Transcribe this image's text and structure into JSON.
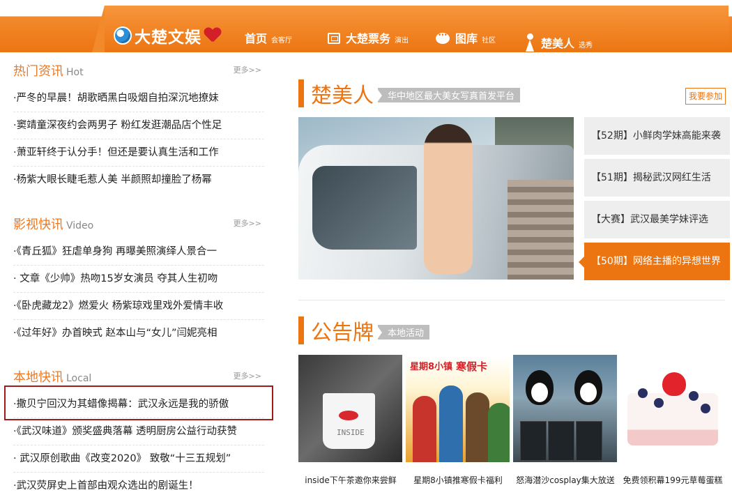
{
  "nav": {
    "logo_text": "大楚文娱",
    "items": [
      {
        "label": "首页",
        "sub": "会客厅"
      },
      {
        "label": "大楚票务",
        "sub": "演出"
      },
      {
        "label": "图库",
        "sub": "社区"
      },
      {
        "label": "楚美人",
        "sub": "选秀"
      }
    ]
  },
  "hot": {
    "title_cn": "热门资讯",
    "title_en": "Hot",
    "more": "更多>>",
    "items": [
      "·严冬的早晨！胡歌晒黑白吸烟自拍深沉地撩妹",
      "·窦靖童深夜约会两男子 粉红发逛潮品店个性足",
      "·萧亚轩终于认分手！但还是要认真生活和工作",
      "·杨紫大眼长睫毛惹人美 半颜照却撞脸了杨幂"
    ]
  },
  "video": {
    "title_cn": "影视快讯",
    "title_en": "Video",
    "more": "更多>>",
    "items": [
      "·《青丘狐》狂虐单身狗 再曝美照演绎人景合一",
      "· 文章《少帅》热吻15岁女演员 夺其人生初吻",
      "·《卧虎藏龙2》燃爱火 杨紫琼戏里戏外爱情丰收",
      "·《过年好》办首映式 赵本山与“女儿”闫妮亮相"
    ]
  },
  "local": {
    "title_cn": "本地快讯",
    "title_en": "Local",
    "more": "更多>>",
    "items": [
      "·撒贝宁回汉为其蜡像揭幕：武汉永远是我的骄傲",
      "·《武汉味道》颁奖盛典落幕 透明厨房公益行动获赞",
      "· 武汉原创歌曲《改变2020》 致敬“十三五规划”",
      "·武汉荧屏史上首部由观众选出的剧诞生！"
    ]
  },
  "beauty": {
    "title": "楚美人",
    "tag": "华中地区最大美女写真首发平台",
    "join": "我要参加",
    "issues": [
      "【52期】小鲜肉学妹高能来袭",
      "【51期】揭秘武汉网红生活",
      "【大赛】武汉最美学妹评选",
      "【50期】网络主播的异想世界"
    ]
  },
  "board": {
    "title": "公告牌",
    "tag": "本地活动",
    "thumb_texts": {
      "t1_word": "INSIDE",
      "t2_brand": "星期8小镇",
      "t2_title": "寒假卡"
    },
    "captions": [
      "inside下午茶邀你来尝鲜",
      "星期8小镇推寒假卡福利",
      "怒海潜沙cosplay集大放送",
      "免费领积幕199元草莓蛋糕"
    ]
  },
  "colors": {
    "accent": "#ec7512",
    "highlight_border": "#a11a1a"
  }
}
